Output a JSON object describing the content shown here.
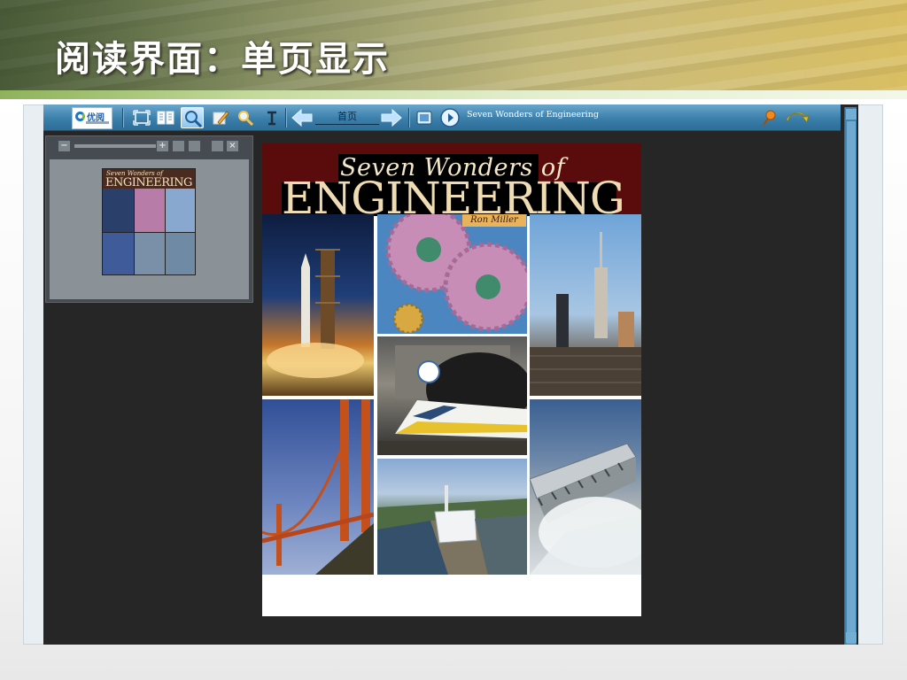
{
  "slide": {
    "title": "阅读界面：单页显示"
  },
  "reader": {
    "logo_text": "优阅",
    "nav_page_label": "首页",
    "book_title": "Seven Wonders of Engineering",
    "toolbar_icons": [
      "fit-page-icon",
      "two-page-icon",
      "zoom-icon",
      "annotate-icon",
      "search-icon",
      "text-mode-icon",
      "prev-page-icon",
      "next-page-icon",
      "thumbnail-icon",
      "play-icon",
      "bookmark-pin-icon",
      "return-icon"
    ],
    "thumbnail_panel": {
      "zoom_out": "−",
      "zoom_in": "+",
      "close": "×"
    }
  },
  "cover": {
    "subtitle": "Seven Wonders of",
    "title": "ENGINEERING",
    "author": "Ron Miller",
    "photos": [
      "rocket launch",
      "gears",
      "Empire State Building",
      "Euro tunnel train",
      "Golden Gate Bridge",
      "Panama Canal",
      "Three Gorges Dam"
    ]
  },
  "colors": {
    "toolbar": "#3b7fab",
    "reader_background": "#262626",
    "cover_banner": "#5a0b0b",
    "slide_accent": "#8eb25a"
  }
}
